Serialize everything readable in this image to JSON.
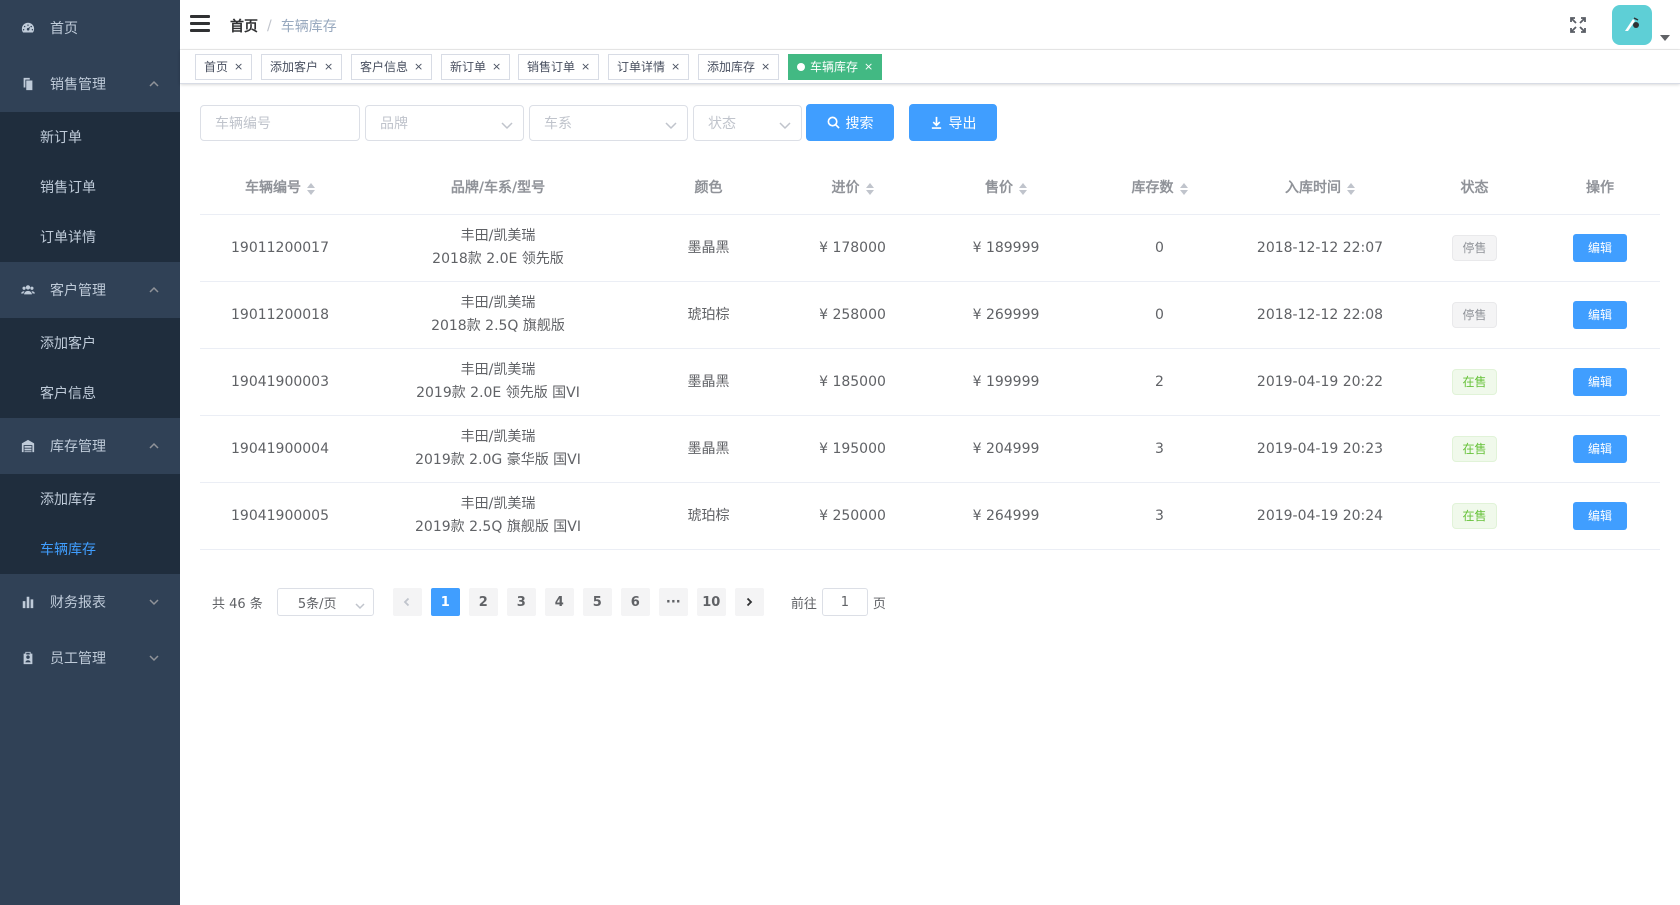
{
  "sidebar": {
    "items": [
      {
        "label": "首页",
        "icon": "dashboard-icon"
      },
      {
        "label": "销售管理",
        "icon": "copy-icon",
        "expanded": true,
        "children": [
          "新订单",
          "销售订单",
          "订单详情"
        ]
      },
      {
        "label": "客户管理",
        "icon": "peoples-icon",
        "expanded": true,
        "children": [
          "添加客户",
          "客户信息"
        ]
      },
      {
        "label": "库存管理",
        "icon": "warehouse-icon",
        "expanded": true,
        "children": [
          "添加库存",
          "车辆库存"
        ]
      },
      {
        "label": "财务报表",
        "icon": "bar-chart-icon",
        "expanded": false
      },
      {
        "label": "员工管理",
        "icon": "clipboard-icon",
        "expanded": false
      }
    ],
    "active": "车辆库存"
  },
  "header": {
    "breadcrumb": {
      "home": "首页",
      "separator": "/",
      "current": "车辆库存"
    }
  },
  "tags": [
    "首页",
    "添加客户",
    "客户信息",
    "新订单",
    "销售订单",
    "订单详情",
    "添加库存",
    "车辆库存"
  ],
  "active_tag": "车辆库存",
  "filters": {
    "vehicle_no_placeholder": "车辆编号",
    "brand_placeholder": "品牌",
    "series_placeholder": "车系",
    "status_placeholder": "状态",
    "search_label": "搜索",
    "export_label": "导出"
  },
  "table": {
    "headers": [
      "车辆编号",
      "品牌/车系/型号",
      "颜色",
      "进价",
      "售价",
      "库存数",
      "入库时间",
      "状态",
      "操作"
    ],
    "rows": [
      {
        "no": "19011200017",
        "model_line1": "丰田/凯美瑞",
        "model_line2": "2018款 2.0E 领先版",
        "color": "墨晶黑",
        "cost": "¥ 178000",
        "price": "¥ 189999",
        "stock": "0",
        "time": "2018-12-12 22:07",
        "status": "停售",
        "status_type": "off",
        "action": "编辑"
      },
      {
        "no": "19011200018",
        "model_line1": "丰田/凯美瑞",
        "model_line2": "2018款 2.5Q 旗舰版",
        "color": "琥珀棕",
        "cost": "¥ 258000",
        "price": "¥ 269999",
        "stock": "0",
        "time": "2018-12-12 22:08",
        "status": "停售",
        "status_type": "off",
        "action": "编辑"
      },
      {
        "no": "19041900003",
        "model_line1": "丰田/凯美瑞",
        "model_line2": "2019款 2.0E 领先版 国VI",
        "color": "墨晶黑",
        "cost": "¥ 185000",
        "price": "¥ 199999",
        "stock": "2",
        "time": "2019-04-19 20:22",
        "status": "在售",
        "status_type": "on",
        "action": "编辑"
      },
      {
        "no": "19041900004",
        "model_line1": "丰田/凯美瑞",
        "model_line2": "2019款 2.0G 豪华版 国VI",
        "color": "墨晶黑",
        "cost": "¥ 195000",
        "price": "¥ 204999",
        "stock": "3",
        "time": "2019-04-19 20:23",
        "status": "在售",
        "status_type": "on",
        "action": "编辑"
      },
      {
        "no": "19041900005",
        "model_line1": "丰田/凯美瑞",
        "model_line2": "2019款 2.5Q 旗舰版 国VI",
        "color": "琥珀棕",
        "cost": "¥ 250000",
        "price": "¥ 264999",
        "stock": "3",
        "time": "2019-04-19 20:24",
        "status": "在售",
        "status_type": "on",
        "action": "编辑"
      }
    ]
  },
  "pagination": {
    "total_text": "共 46 条",
    "page_size": "5条/页",
    "pages": [
      "1",
      "2",
      "3",
      "4",
      "5",
      "6",
      "···",
      "10"
    ],
    "current": "1",
    "goto_label": "前往",
    "goto_value": "1",
    "page_suffix": "页"
  },
  "colors": {
    "sidebar_bg": "#304156",
    "submenu_bg": "#1f2d3d",
    "primary": "#409eff",
    "active_tag": "#42b983"
  }
}
